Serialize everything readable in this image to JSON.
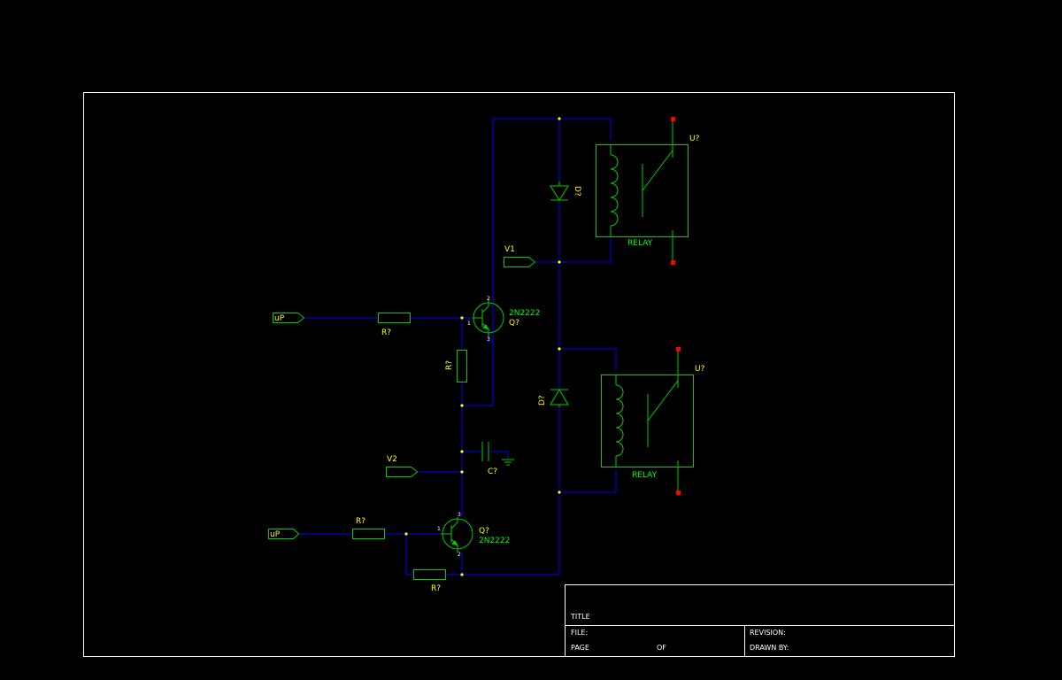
{
  "colors": {
    "background": "#000000",
    "wire": "#0000ff",
    "symbol": "#00cc00",
    "label_yellow": "#ffff00",
    "label_green": "#00ff00",
    "pin_red": "#ff0000",
    "border": "#ffffff"
  },
  "components": {
    "relay_top": {
      "ref": "U?",
      "value": "RELAY"
    },
    "relay_bottom": {
      "ref": "U?",
      "value": "RELAY"
    },
    "diode_top": {
      "ref": "D?"
    },
    "diode_bottom": {
      "ref": "D?"
    },
    "q_top": {
      "ref": "Q?",
      "value": "2N2222",
      "pin_c": "2",
      "pin_b": "1",
      "pin_e": "3"
    },
    "q_bottom": {
      "ref": "Q?",
      "value": "2N2222",
      "pin_c": "3",
      "pin_b": "1",
      "pin_e": "2"
    },
    "r_base_top": {
      "ref": "R?"
    },
    "r_pull_top": {
      "ref": "R?"
    },
    "r_base_bottom": {
      "ref": "R?"
    },
    "r_pull_bottom": {
      "ref": "R?"
    },
    "cap": {
      "ref": "C?"
    }
  },
  "ports": {
    "up_top": "uP",
    "up_bottom": "uP",
    "v1": "V1",
    "v2": "V2"
  },
  "title_block": {
    "title": "TITLE",
    "file": "FILE:",
    "page": "PAGE",
    "of": "OF",
    "revision": "REVISION:",
    "drawn_by": "DRAWN BY:"
  }
}
